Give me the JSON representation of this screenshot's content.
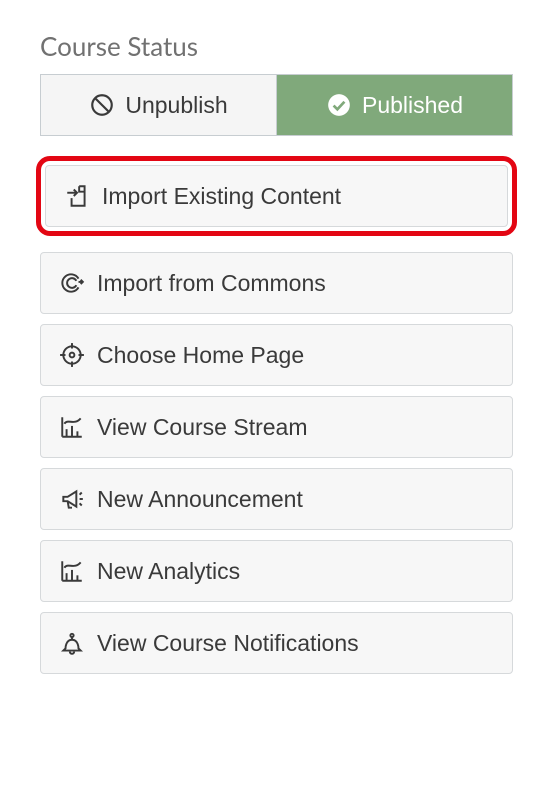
{
  "heading": "Course Status",
  "status": {
    "unpublish_label": "Unpublish",
    "published_label": "Published"
  },
  "actions": {
    "import_existing": "Import Existing Content",
    "import_commons": "Import from Commons",
    "choose_home": "Choose Home Page",
    "view_stream": "View Course Stream",
    "new_announcement": "New Announcement",
    "new_analytics": "New Analytics",
    "view_notifications": "View Course Notifications"
  },
  "highlighted": "import_existing"
}
